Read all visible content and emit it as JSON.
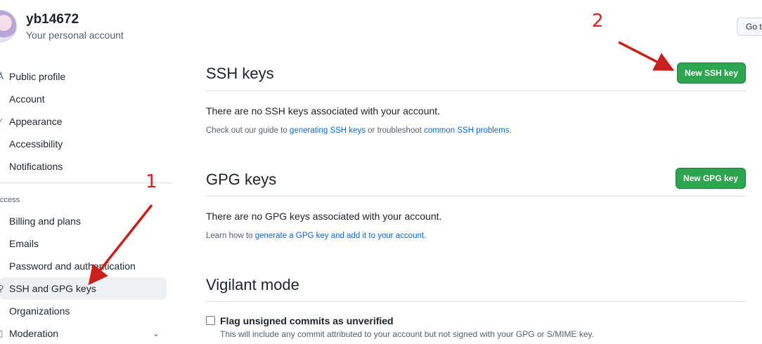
{
  "user": {
    "name": "yb14672",
    "subtitle": "Your personal account"
  },
  "header": {
    "goto_label": "Go t"
  },
  "sidebar": {
    "items": [
      {
        "label": "Public profile",
        "icon": "person-icon",
        "glyph": "Å"
      },
      {
        "label": "Account",
        "icon": "gear-icon",
        "glyph": ""
      },
      {
        "label": "Appearance",
        "icon": "paintbrush-icon",
        "glyph": "⁄"
      },
      {
        "label": "Accessibility",
        "icon": "accessibility-icon",
        "glyph": ""
      },
      {
        "label": "Notifications",
        "icon": "bell-icon",
        "glyph": ""
      }
    ],
    "access_heading": "ccess",
    "access_items": [
      {
        "label": "Billing and plans",
        "icon": "credit-card-icon",
        "glyph": ""
      },
      {
        "label": "Emails",
        "icon": "mail-icon",
        "glyph": ""
      },
      {
        "label": "Password and authentication",
        "icon": "shield-lock-icon",
        "glyph": ""
      },
      {
        "label": "SSH and GPG keys",
        "icon": "key-icon",
        "glyph": "⚲"
      },
      {
        "label": "Organizations",
        "icon": "organization-icon",
        "glyph": ""
      },
      {
        "label": "Moderation",
        "icon": "report-icon",
        "glyph": "▯",
        "chevron": "⌄"
      }
    ]
  },
  "ssh": {
    "title": "SSH keys",
    "button": "New SSH key",
    "empty": "There are no SSH keys associated with your account.",
    "note_prefix": "Check out our guide to ",
    "note_link1": "generating SSH keys",
    "note_mid": " or troubleshoot ",
    "note_link2": "common SSH problems",
    "note_suffix": "."
  },
  "gpg": {
    "title": "GPG keys",
    "button": "New GPG key",
    "empty": "There are no GPG keys associated with your account.",
    "note_prefix": "Learn how to ",
    "note_link": "generate a GPG key and add it to your account",
    "note_suffix": "."
  },
  "vigilant": {
    "title": "Vigilant mode",
    "checkbox_label": "Flag unsigned commits as unverified",
    "checkbox_desc": "This will include any commit attributed to your account but not signed with your GPG or S/MIME key."
  },
  "annotations": {
    "one": "1",
    "two": "2",
    "color": "#e02020"
  },
  "colors": {
    "button_green": "#2da44e",
    "link_blue": "#0969da"
  }
}
